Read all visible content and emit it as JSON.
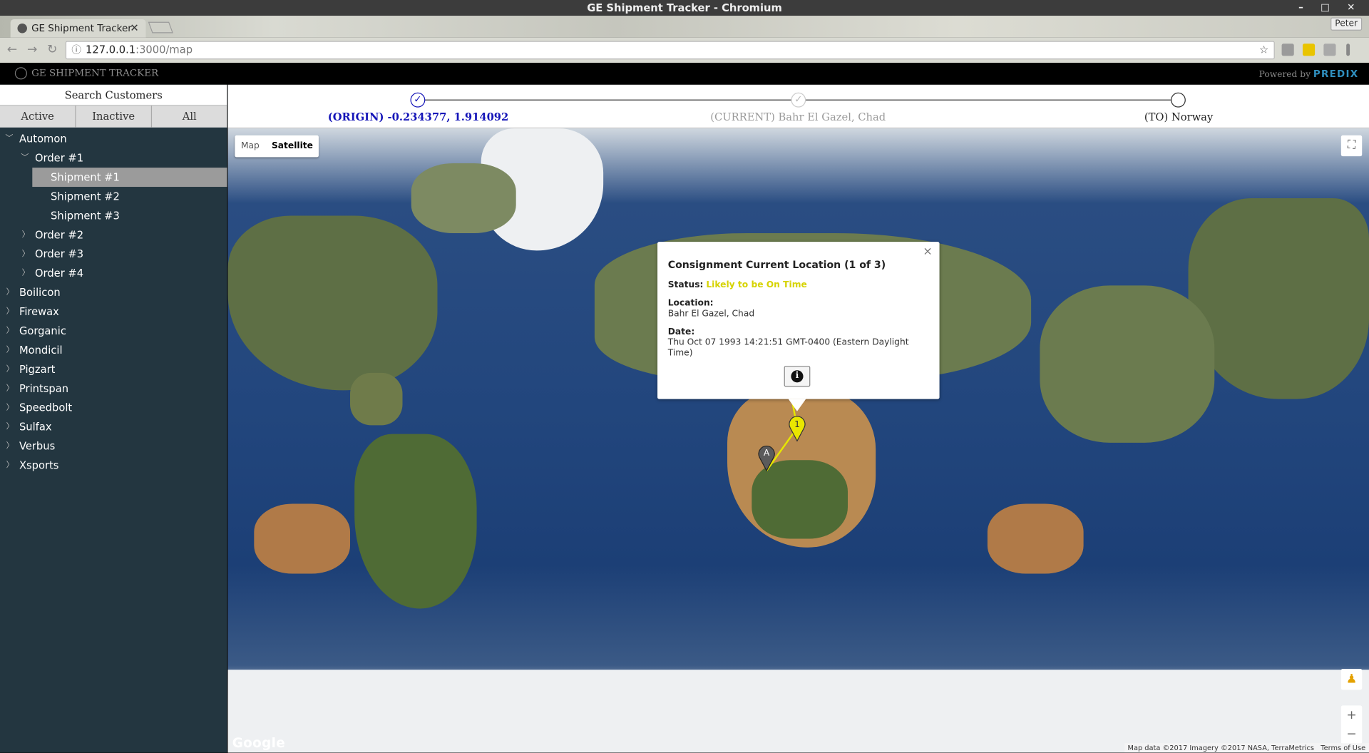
{
  "window": {
    "title": "GE Shipment Tracker - Chromium",
    "controls": "– □ ✕"
  },
  "browser": {
    "tab_title": "GE Shipment Tracker",
    "profile": "Peter",
    "url_host": "127.0.0.1",
    "url_path": ":3000/map"
  },
  "app": {
    "brand": "GE SHIPMENT TRACKER",
    "powered_by": "Powered by",
    "predix": "PREDIX"
  },
  "sidebar": {
    "search_title": "Search Customers",
    "filters": [
      "Active",
      "Inactive",
      "All"
    ],
    "tree": {
      "customer0": "Automon",
      "order1": "Order #1",
      "shipments": [
        "Shipment #1",
        "Shipment #2",
        "Shipment #3"
      ],
      "orders": [
        "Order #2",
        "Order #3",
        "Order #4"
      ],
      "customers": [
        "Boilicon",
        "Firewax",
        "Gorganic",
        "Mondicil",
        "Pigzart",
        "Printspan",
        "Speedbolt",
        "Sulfax",
        "Verbus",
        "Xsports"
      ]
    }
  },
  "stepper": {
    "origin": "(ORIGIN) -0.234377, 1.914092",
    "current": "(CURRENT) Bahr El Gazel, Chad",
    "to": "(TO) Norway",
    "origin_color": "#1515b8",
    "current_color": "#9a9a9a"
  },
  "map": {
    "type_map": "Map",
    "type_satellite": "Satellite",
    "zoom_in": "+",
    "zoom_out": "−",
    "google": "Google",
    "attribution": "Map data ©2017 Imagery ©2017 NASA, TerraMetrics",
    "terms": "Terms of Use",
    "marker_current": "1",
    "marker_origin": "A"
  },
  "infowindow": {
    "title": "Consignment Current Location (1 of 3)",
    "status_label": "Status:",
    "status_value": "Likely to be On Time",
    "location_label": "Location:",
    "location_value": "Bahr El Gazel, Chad",
    "date_label": "Date:",
    "date_value": "Thu Oct 07 1993 14:21:51 GMT-0400 (Eastern Daylight Time)",
    "close": "×",
    "info_icon": "i"
  }
}
